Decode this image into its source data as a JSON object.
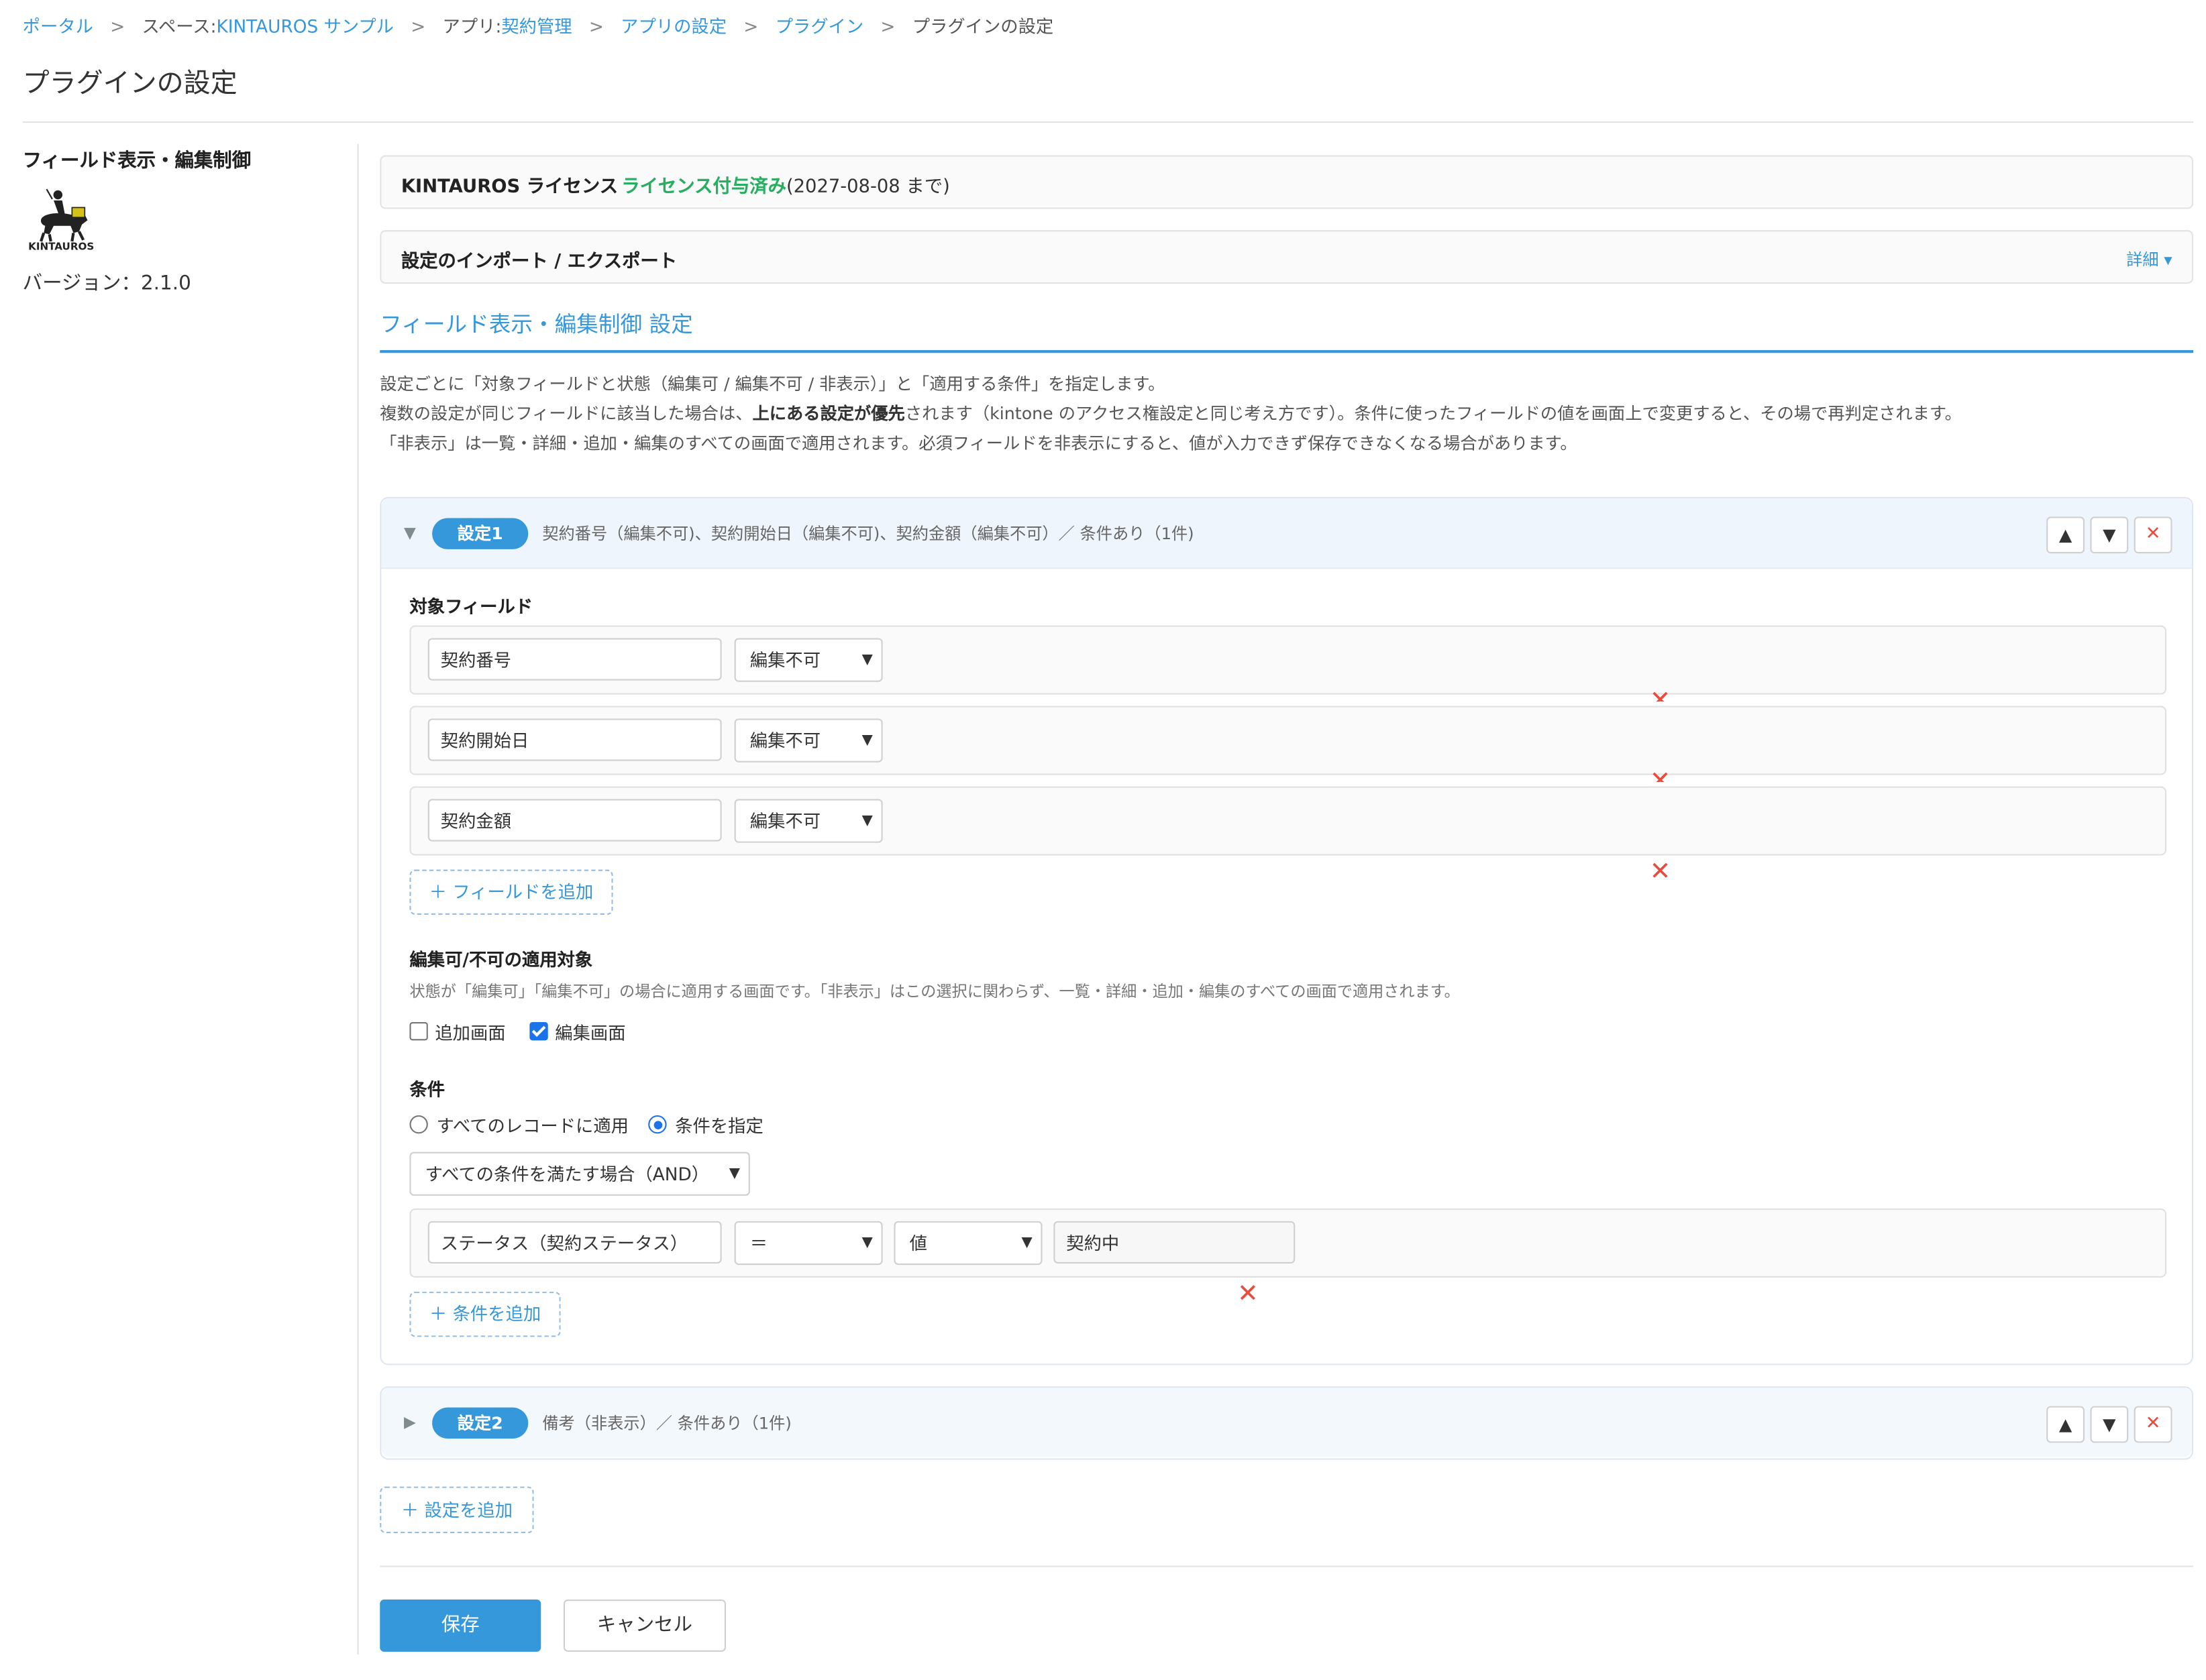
{
  "breadcrumb": {
    "portal": "ポータル",
    "space_prefix": "スペース: ",
    "space": "KINTAUROS サンプル",
    "app_prefix": "アプリ: ",
    "app": "契約管理",
    "app_settings": "アプリの設定",
    "plugins": "プラグイン",
    "current": "プラグインの設定",
    "separator": ">"
  },
  "page_title": "プラグインの設定",
  "sidebar": {
    "plugin_name": "フィールド表示・編集制御",
    "logo_text": "KINTAUROS",
    "version": "バージョン：2.1.0"
  },
  "license": {
    "label": "KINTAUROS ライセンス",
    "status": "ライセンス付与済み",
    "until": "(2027-08-08 まで)"
  },
  "import_export": {
    "label": "設定のインポート / エクスポート",
    "detail": "詳細 ▾"
  },
  "section": {
    "title": "フィールド表示・編集制御 設定",
    "desc_line1": "設定ごとに「対象フィールドと状態（編集可 / 編集不可 / 非表示）」と「適用する条件」を指定します。",
    "desc_line2_a": "複数の設定が同じフィールドに該当した場合は、",
    "desc_line2_b": "上にある設定が優先",
    "desc_line2_c": "されます（kintone のアクセス権設定と同じ考え方です）。条件に使ったフィールドの値を画面上で変更すると、その場で再判定されます。",
    "desc_line3": "「非表示」は一覧・詳細・追加・編集のすべての画面で適用されます。必須フィールドを非表示にすると、値が入力できず保存できなくなる場合があります。"
  },
  "setting1": {
    "toggle": "▼",
    "pill": "設定1",
    "summary": "契約番号（編集不可)、契約開始日（編集不可)、契約金額（編集不可）／ 条件あり（1件)",
    "up": "▲",
    "down": "▼",
    "delete": "✕",
    "target_label": "対象フィールド",
    "fields": [
      {
        "name": "契約番号",
        "state": "編集不可"
      },
      {
        "name": "契約開始日",
        "state": "編集不可"
      },
      {
        "name": "契約金額",
        "state": "編集不可"
      }
    ],
    "add_field": "＋ フィールドを追加",
    "apply_label": "編集可/不可の適用対象",
    "apply_help": "状態が「編集可」「編集不可」の場合に適用する画面です。「非表示」はこの選択に関わらず、一覧・詳細・追加・編集のすべての画面で適用されます。",
    "apply_add": "追加画面",
    "apply_edit": "編集画面",
    "condition_label": "条件",
    "cond_all": "すべてのレコードに適用",
    "cond_specify": "条件を指定",
    "logic": "すべての条件を満たす場合（AND）",
    "condition": {
      "field": "ステータス（契約ステータス）",
      "operator": "＝",
      "type": "値",
      "value": "契約中"
    },
    "add_condition": "＋ 条件を追加"
  },
  "setting2": {
    "toggle": "▶",
    "pill": "設定2",
    "summary": "備考（非表示）／ 条件あり（1件)",
    "up": "▲",
    "down": "▼",
    "delete": "✕"
  },
  "add_setting": "＋ 設定を追加",
  "save": "保存",
  "cancel": "キャンセル",
  "colors": {
    "accent": "#3498db",
    "license_ok": "#27ae60",
    "danger": "#e74c3c"
  }
}
